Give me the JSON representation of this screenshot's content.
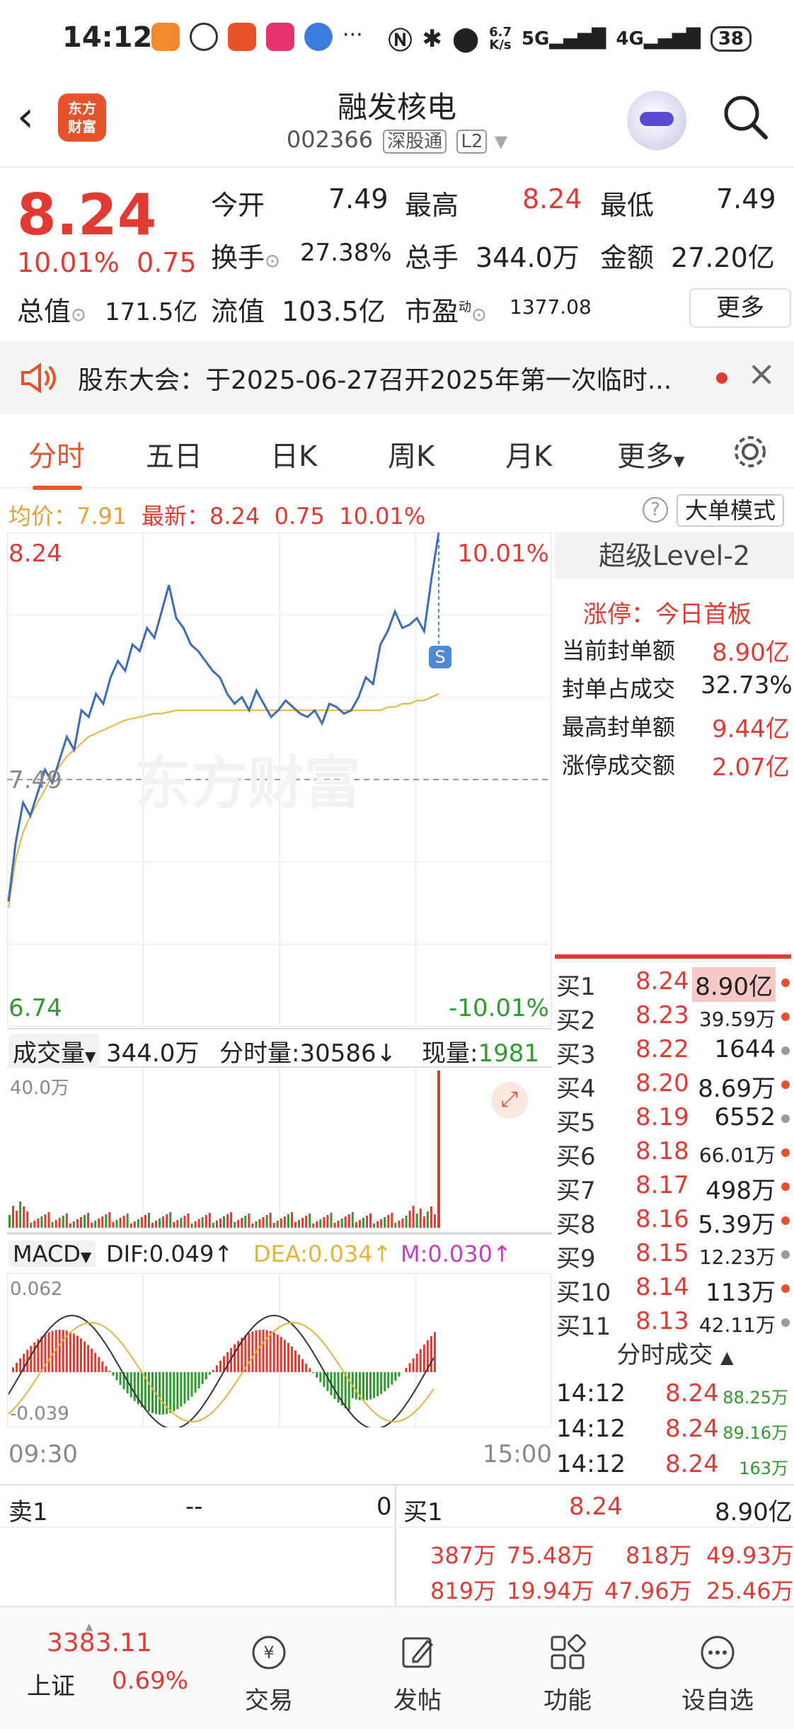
{
  "status": {
    "time": "14:12",
    "net_speed_top": "6.7",
    "net_speed_bottom": "K/s",
    "sig1": "5G",
    "sig2": "4G",
    "battery": "38",
    "more": "···"
  },
  "header": {
    "title": "融发核电",
    "code": "002366",
    "tag1": "深股通",
    "tag2": "L2",
    "logo_line1": "东方",
    "logo_line2": "财富"
  },
  "quote": {
    "price": "8.24",
    "pct": "10.01%",
    "chg": "0.75",
    "open_l": "今开",
    "open_v": "7.49",
    "high_l": "最高",
    "high_v": "8.24",
    "low_l": "最低",
    "low_v": "7.49",
    "turn_l": "换手",
    "turn_v": "27.38%",
    "vol_l": "总手",
    "vol_v": "344.0万",
    "amt_l": "金额",
    "amt_v": "27.20亿",
    "mcap_l": "总值",
    "mcap_v": "171.5亿",
    "fcap_l": "流值",
    "fcap_v": "103.5亿",
    "pe_l": "市盈",
    "pe_sup": "动",
    "pe_v": "1377.08",
    "more": "更多"
  },
  "notice": {
    "text": "股东大会：于2025-06-27召开2025年第一次临时..."
  },
  "tabs": [
    "分时",
    "五日",
    "日K",
    "周K",
    "月K",
    "更多"
  ],
  "infobar": {
    "avg_l": "均价：",
    "avg_v": "7.91",
    "last_l": "最新：",
    "last_v": "8.24",
    "chg": "0.75",
    "pct": "10.01%",
    "mode": "大单模式"
  },
  "chart": {
    "top_price": "8.24",
    "top_pct": "10.01%",
    "mid_price": "7.49",
    "bot_price": "6.74",
    "bot_pct": "-10.01%",
    "watermark": "东方财富",
    "s_marker": "S",
    "vol_label": "成交量",
    "vol_total": "344.0万",
    "fen_l": "分时量:",
    "fen_v": "30586",
    "fen_arrow": "↓",
    "now_l": "现量:",
    "now_v": "1981",
    "vol_max": "40.0万",
    "macd_label": "MACD",
    "dif": "DIF:0.049↑",
    "dea": "DEA:0.034↑",
    "m": "M:0.030↑",
    "macd_top": "0.062",
    "macd_bot": "-0.039",
    "t_start": "09:30",
    "t_end": "15:00"
  },
  "chart_data": {
    "type": "line",
    "title": "",
    "ylim": [
      6.74,
      8.24
    ],
    "prev_close": 7.49,
    "price": [
      7.12,
      7.3,
      7.42,
      7.38,
      7.45,
      7.52,
      7.48,
      7.55,
      7.62,
      7.58,
      7.7,
      7.68,
      7.75,
      7.72,
      7.8,
      7.85,
      7.82,
      7.9,
      7.88,
      7.95,
      7.92,
      8.0,
      8.08,
      7.98,
      7.95,
      7.9,
      7.88,
      7.85,
      7.82,
      7.8,
      7.75,
      7.72,
      7.74,
      7.7,
      7.76,
      7.72,
      7.68,
      7.7,
      7.73,
      7.71,
      7.69,
      7.68,
      7.7,
      7.66,
      7.72,
      7.71,
      7.69,
      7.7,
      7.74,
      7.8,
      7.78,
      7.9,
      7.94,
      8.0,
      7.95,
      7.96,
      7.98,
      7.94,
      8.1,
      8.24
    ],
    "avg": [
      7.1,
      7.25,
      7.33,
      7.38,
      7.42,
      7.46,
      7.5,
      7.53,
      7.56,
      7.58,
      7.6,
      7.62,
      7.63,
      7.64,
      7.65,
      7.66,
      7.67,
      7.675,
      7.68,
      7.685,
      7.69,
      7.69,
      7.695,
      7.7,
      7.7,
      7.7,
      7.7,
      7.7,
      7.7,
      7.7,
      7.7,
      7.7,
      7.7,
      7.7,
      7.7,
      7.7,
      7.7,
      7.7,
      7.7,
      7.7,
      7.7,
      7.7,
      7.7,
      7.7,
      7.7,
      7.7,
      7.7,
      7.7,
      7.7,
      7.7,
      7.7,
      7.7,
      7.71,
      7.71,
      7.72,
      7.72,
      7.73,
      7.73,
      7.74,
      7.75
    ]
  },
  "level2": {
    "title": "超级Level-2",
    "zt_l": "涨停：",
    "zt_v": "今日首板",
    "rows": [
      {
        "l": "当前封单额",
        "v": "8.90亿"
      },
      {
        "l": "封单占成交",
        "v": "32.73%"
      },
      {
        "l": "最高封单额",
        "v": "9.44亿"
      },
      {
        "l": "涨停成交额",
        "v": "2.07亿"
      }
    ]
  },
  "bids": [
    {
      "l": "买1",
      "p": "8.24",
      "v": "8.90亿"
    },
    {
      "l": "买2",
      "p": "8.23",
      "v": "39.59万"
    },
    {
      "l": "买3",
      "p": "8.22",
      "v": "1644"
    },
    {
      "l": "买4",
      "p": "8.20",
      "v": "8.69万"
    },
    {
      "l": "买5",
      "p": "8.19",
      "v": "6552"
    },
    {
      "l": "买6",
      "p": "8.18",
      "v": "66.01万"
    },
    {
      "l": "买7",
      "p": "8.17",
      "v": "498万"
    },
    {
      "l": "买8",
      "p": "8.16",
      "v": "5.39万"
    },
    {
      "l": "买9",
      "p": "8.15",
      "v": "12.23万"
    },
    {
      "l": "买10",
      "p": "8.14",
      "v": "113万"
    },
    {
      "l": "买11",
      "p": "8.13",
      "v": "42.11万"
    }
  ],
  "ticks": {
    "title": "分时成交",
    "rows": [
      {
        "t": "14:12",
        "p": "8.24",
        "v": "88.25万"
      },
      {
        "t": "14:12",
        "p": "8.24",
        "v": "89.16万"
      },
      {
        "t": "14:12",
        "p": "8.24",
        "v": "163万"
      }
    ]
  },
  "book": {
    "sell_l": "卖1",
    "sell_p": "--",
    "sell_v": "0",
    "buy_l": "买1",
    "buy_p": "8.24",
    "buy_v": "8.90亿",
    "r1": [
      "387万",
      "75.48万",
      "818万",
      "49.93万"
    ],
    "r2": [
      "819万",
      "19.94万",
      "47.96万",
      "25.46万"
    ]
  },
  "nav": {
    "index_v": "3383.11",
    "index_name": "上证",
    "index_pct": "0.69%",
    "items": [
      "交易",
      "发帖",
      "功能",
      "设自选"
    ]
  }
}
